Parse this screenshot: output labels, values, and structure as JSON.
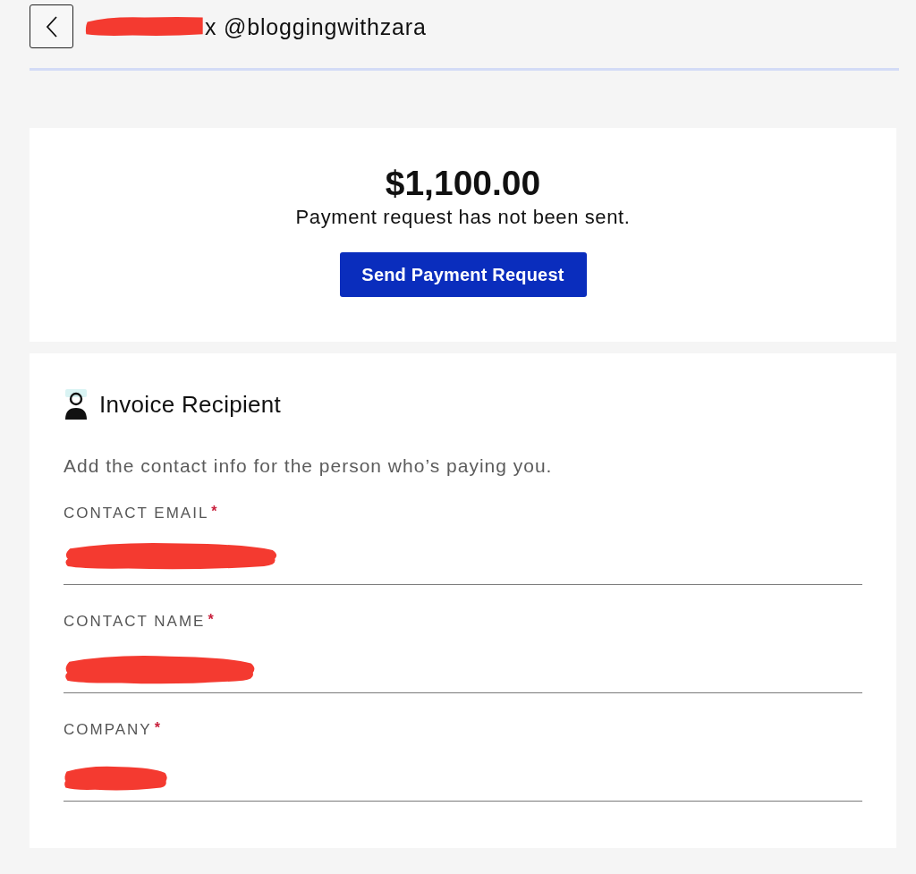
{
  "header": {
    "name_redacted": true,
    "title": "x @bloggingwithzara"
  },
  "payment": {
    "amount": "$1,100.00",
    "status": "Payment request has not been sent.",
    "button": "Send Payment Request"
  },
  "recipient": {
    "title": "Invoice Recipient",
    "description": "Add the contact info for the person who’s paying you.",
    "fields": [
      {
        "label": "CONTACT EMAIL",
        "required_mark": "*",
        "redacted": true
      },
      {
        "label": "CONTACT NAME",
        "required_mark": "*",
        "redacted": true
      },
      {
        "label": "COMPANY",
        "required_mark": "*",
        "redacted": true
      }
    ]
  }
}
